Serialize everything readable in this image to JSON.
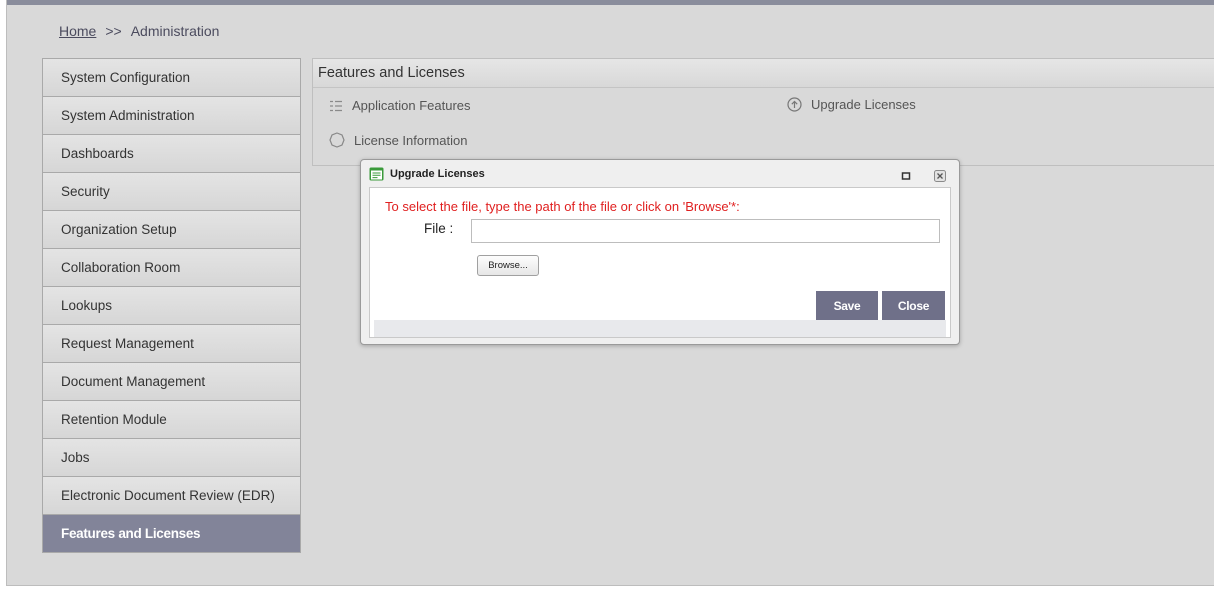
{
  "breadcrumb": {
    "home": "Home",
    "separator": ">>",
    "current": "Administration"
  },
  "sidebar": {
    "items": [
      {
        "label": "System Configuration"
      },
      {
        "label": "System Administration"
      },
      {
        "label": "Dashboards"
      },
      {
        "label": "Security"
      },
      {
        "label": "Organization Setup"
      },
      {
        "label": "Collaboration Room"
      },
      {
        "label": "Lookups"
      },
      {
        "label": "Request Management"
      },
      {
        "label": "Document Management"
      },
      {
        "label": "Retention Module"
      },
      {
        "label": "Jobs"
      },
      {
        "label": "Electronic Document Review (EDR)"
      },
      {
        "label": "Features and Licenses",
        "active": true
      }
    ]
  },
  "panel": {
    "title": "Features and Licenses",
    "links": {
      "application_features": {
        "label": "Application Features",
        "icon": "list-icon"
      },
      "upgrade_licenses": {
        "label": "Upgrade Licenses",
        "icon": "upload-circle-icon"
      },
      "license_information": {
        "label": "License Information",
        "icon": "license-badge-icon"
      }
    }
  },
  "dialog": {
    "title": "Upgrade Licenses",
    "instruction": "To select the file, type the path of the file or click on 'Browse'*:",
    "file_label": "File  :",
    "file_value": "",
    "browse_label": "Browse...",
    "save_label": "Save",
    "close_label": "Close"
  },
  "colors": {
    "accent": "#6f7089",
    "active_sidebar": "#828499",
    "instruction_text": "#e02020",
    "background": "#d9d9d9"
  }
}
